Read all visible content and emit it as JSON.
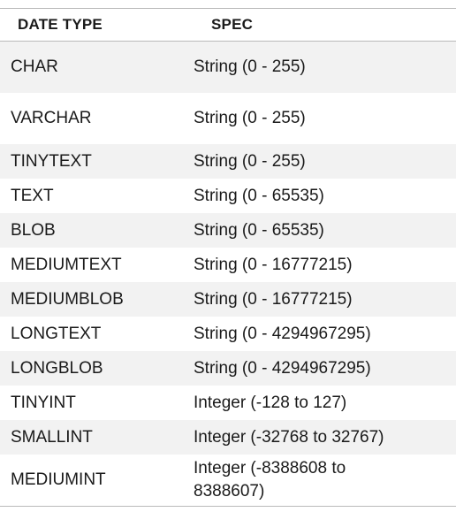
{
  "table": {
    "headers": [
      "DATE TYPE",
      "SPEC"
    ],
    "rows": [
      {
        "type": "CHAR",
        "spec": "String (0 - 255)"
      },
      {
        "type": "VARCHAR",
        "spec": "String (0 - 255)"
      },
      {
        "type": "TINYTEXT",
        "spec": "String (0 - 255)"
      },
      {
        "type": "TEXT",
        "spec": "String (0 - 65535)"
      },
      {
        "type": "BLOB",
        "spec": "String (0 - 65535)"
      },
      {
        "type": "MEDIUMTEXT",
        "spec": "String (0 - 16777215)"
      },
      {
        "type": "MEDIUMBLOB",
        "spec": "String (0 - 16777215)"
      },
      {
        "type": "LONGTEXT",
        "spec": "String (0 - 4294967295)"
      },
      {
        "type": "LONGBLOB",
        "spec": "String (0 - 4294967295)"
      },
      {
        "type": "TINYINT",
        "spec": "Integer (-128 to 127)"
      },
      {
        "type": "SMALLINT",
        "spec": "Integer (-32768 to 32767)"
      },
      {
        "type": "MEDIUMINT",
        "spec": "Integer (-8388608 to 8388607)"
      }
    ]
  }
}
